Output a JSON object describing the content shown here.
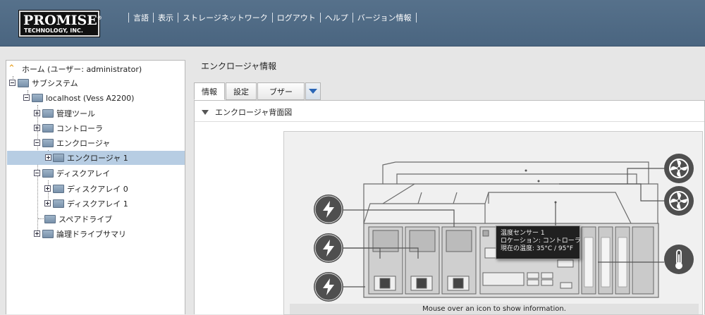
{
  "header": {
    "logo_line1": "PROMISE",
    "logo_reg": "®",
    "logo_line2": "TECHNOLOGY, INC.",
    "nav": [
      "言語",
      "表示",
      "ストレージネットワーク",
      "ログアウト",
      "ヘルプ",
      "バージョン情報"
    ]
  },
  "tree": {
    "home": "ホーム (ユーザー: administrator)",
    "subsystem": "サブシステム",
    "host": "localhost (Vess A2200)",
    "admin_tools": "管理ツール",
    "controller": "コントローラ",
    "enclosure": "エンクロージャ",
    "enclosure1": "エンクロージャ 1",
    "disk_arrays": "ディスクアレイ",
    "disk_array0": "ディスクアレイ 0",
    "disk_array1": "ディスクアレイ 1",
    "spare_drives": "スペアドライブ",
    "logical_summary": "論理ドライブサマリ"
  },
  "main": {
    "title": "エンクロージャ情報",
    "tabs": [
      "情報",
      "設定",
      "ブザー"
    ],
    "section_title": "エンクロージャ背面図",
    "hint": "Mouse over an icon to show information."
  },
  "tooltip": {
    "line1": "温度センサー 1",
    "line2": "ロケーション: コントローラ",
    "line3": "現在の温度: 35°C / 95°F"
  },
  "colors": {
    "header_bg": "#4d6883",
    "selected_row": "#b7cde3",
    "icon_dark": "#4f4f4f",
    "tab_dropdown_arrow": "#2a66b6"
  }
}
